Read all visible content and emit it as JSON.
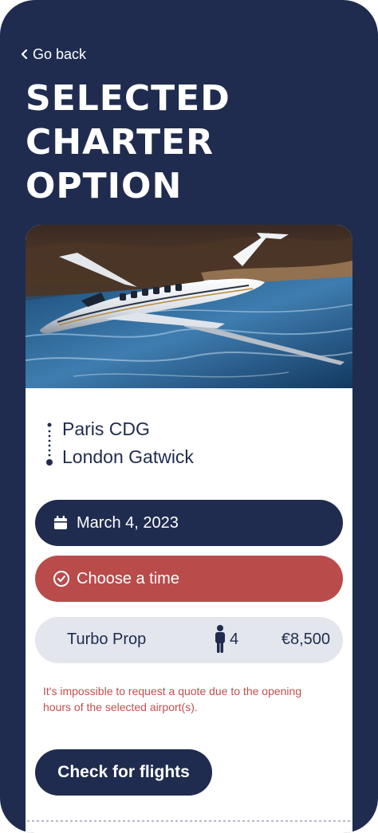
{
  "nav": {
    "back_label": "Go back"
  },
  "page": {
    "title_lines": [
      "SELECTED",
      "CHARTER",
      "OPTION"
    ]
  },
  "route": {
    "origin": "Paris CDG",
    "destination": "London Gatwick"
  },
  "date": {
    "value": "March 4, 2023",
    "icon": "calendar-icon"
  },
  "time": {
    "placeholder": "Choose a time",
    "icon": "clock-icon"
  },
  "option": {
    "aircraft": "Turbo Prop",
    "passengers": "4",
    "price": "€8,500",
    "pax_icon": "person-icon"
  },
  "warning": "It's impossible to request a quote due to the opening hours of the selected airport(s).",
  "actions": {
    "check_flights": "Check for flights"
  },
  "colors": {
    "navy": "#1f2c4f",
    "alert_red": "#b94b4b",
    "option_bg": "#e3e6ec",
    "warning_text": "#c0504d"
  }
}
